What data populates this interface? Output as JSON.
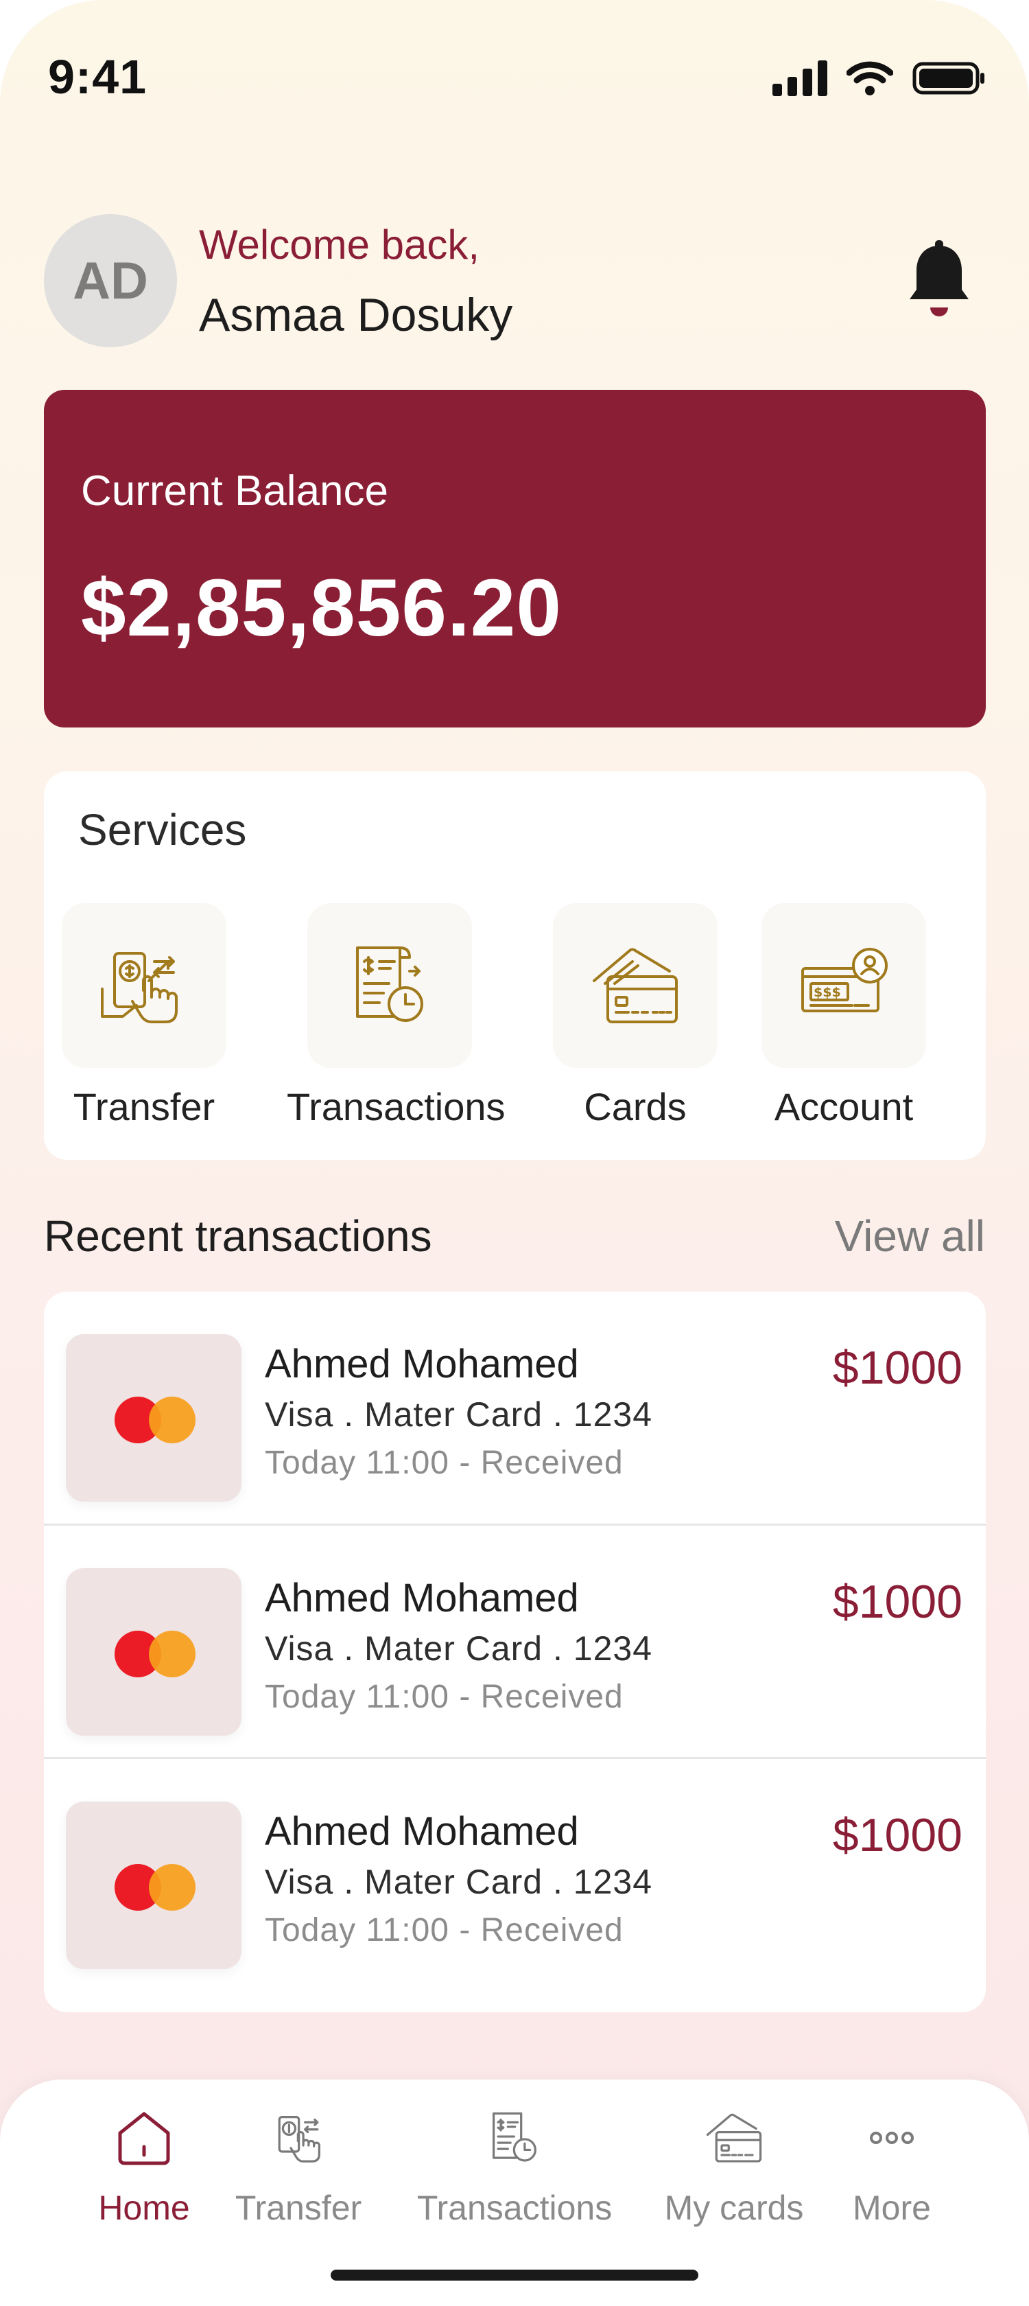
{
  "status_bar": {
    "time": "9:41"
  },
  "header": {
    "avatar_initials": "AD",
    "welcome": "Welcome back,",
    "user_name": "Asmaa Dosuky",
    "notification_icon": "bell-icon"
  },
  "balance": {
    "label": "Current Balance",
    "value": "$2,85,856.20",
    "card_color": "#8a1e35"
  },
  "services": {
    "title": "Services",
    "items": [
      {
        "label": "Transfer",
        "icon": "transfer-icon"
      },
      {
        "label": "Transactions",
        "icon": "transactions-icon"
      },
      {
        "label": "Cards",
        "icon": "cards-icon"
      },
      {
        "label": "Account",
        "icon": "account-icon"
      }
    ]
  },
  "recent": {
    "title": "Recent transactions",
    "view_all": "View all",
    "transactions": [
      {
        "name": "Ahmed Mohamed",
        "card": "Visa . Mater Card . 1234",
        "time": "Today 11:00 - Received",
        "amount": "$1000",
        "logo": "mastercard-logo"
      },
      {
        "name": "Ahmed Mohamed",
        "card": "Visa . Mater Card . 1234",
        "time": "Today 11:00 - Received",
        "amount": "$1000",
        "logo": "mastercard-logo"
      },
      {
        "name": "Ahmed Mohamed",
        "card": "Visa . Mater Card . 1234",
        "time": "Today 11:00 - Received",
        "amount": "$1000",
        "logo": "mastercard-logo"
      }
    ]
  },
  "nav": {
    "items": [
      {
        "label": "Home",
        "icon": "home-icon",
        "active": true
      },
      {
        "label": "Transfer",
        "icon": "transfer-icon",
        "active": false
      },
      {
        "label": "Transactions",
        "icon": "transactions-icon",
        "active": false
      },
      {
        "label": "My cards",
        "icon": "cards-icon",
        "active": false
      },
      {
        "label": "More",
        "icon": "more-icon",
        "active": false
      }
    ]
  },
  "colors": {
    "accent": "#8b1e37",
    "service_icon": "#a07a1c",
    "mastercard_red": "#eb1c26",
    "mastercard_orange": "#f79e1b"
  }
}
